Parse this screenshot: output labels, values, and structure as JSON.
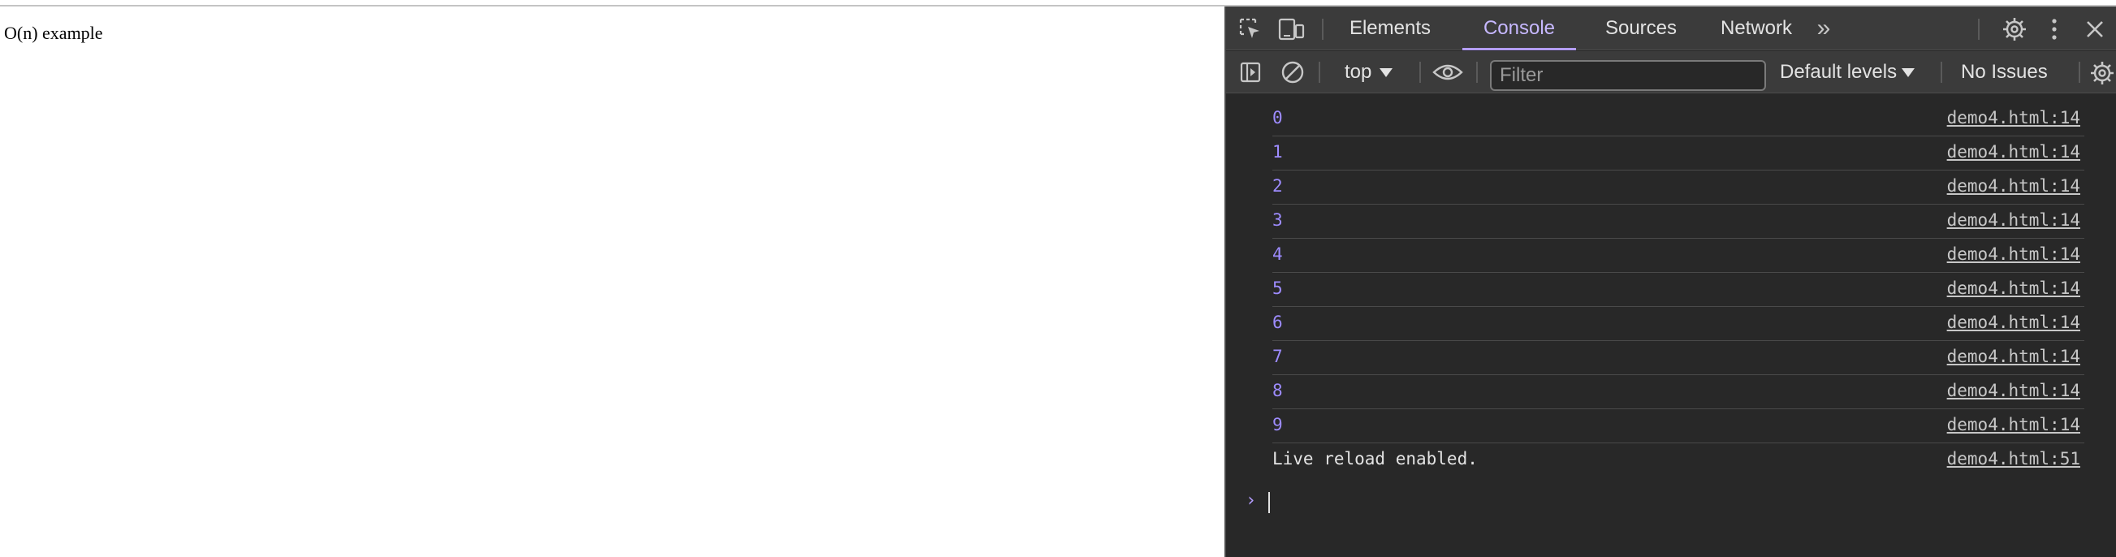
{
  "page": {
    "text": "O(n) example"
  },
  "devtools": {
    "tabs": [
      {
        "label": "Elements",
        "active": false
      },
      {
        "label": "Console",
        "active": true
      },
      {
        "label": "Sources",
        "active": false
      },
      {
        "label": "Network",
        "active": false
      }
    ],
    "more_tabs_glyph": "»",
    "toolbar": {
      "context": "top",
      "filter_placeholder": "Filter",
      "filter_value": "",
      "levels": "Default levels",
      "issues": "No Issues"
    },
    "console": {
      "entries": [
        {
          "value": "0",
          "type": "number",
          "source": "demo4.html:14"
        },
        {
          "value": "1",
          "type": "number",
          "source": "demo4.html:14"
        },
        {
          "value": "2",
          "type": "number",
          "source": "demo4.html:14"
        },
        {
          "value": "3",
          "type": "number",
          "source": "demo4.html:14"
        },
        {
          "value": "4",
          "type": "number",
          "source": "demo4.html:14"
        },
        {
          "value": "5",
          "type": "number",
          "source": "demo4.html:14"
        },
        {
          "value": "6",
          "type": "number",
          "source": "demo4.html:14"
        },
        {
          "value": "7",
          "type": "number",
          "source": "demo4.html:14"
        },
        {
          "value": "8",
          "type": "number",
          "source": "demo4.html:14"
        },
        {
          "value": "9",
          "type": "number",
          "source": "demo4.html:14"
        },
        {
          "value": "Live reload enabled.",
          "type": "string",
          "source": "demo4.html:51"
        }
      ],
      "prompt_glyph": "›"
    },
    "colors": {
      "background": "#282828",
      "toolbar": "#3b3b3b",
      "accent": "#b49dff",
      "number": "#9e8cff",
      "text": "#e3e3e3"
    }
  }
}
